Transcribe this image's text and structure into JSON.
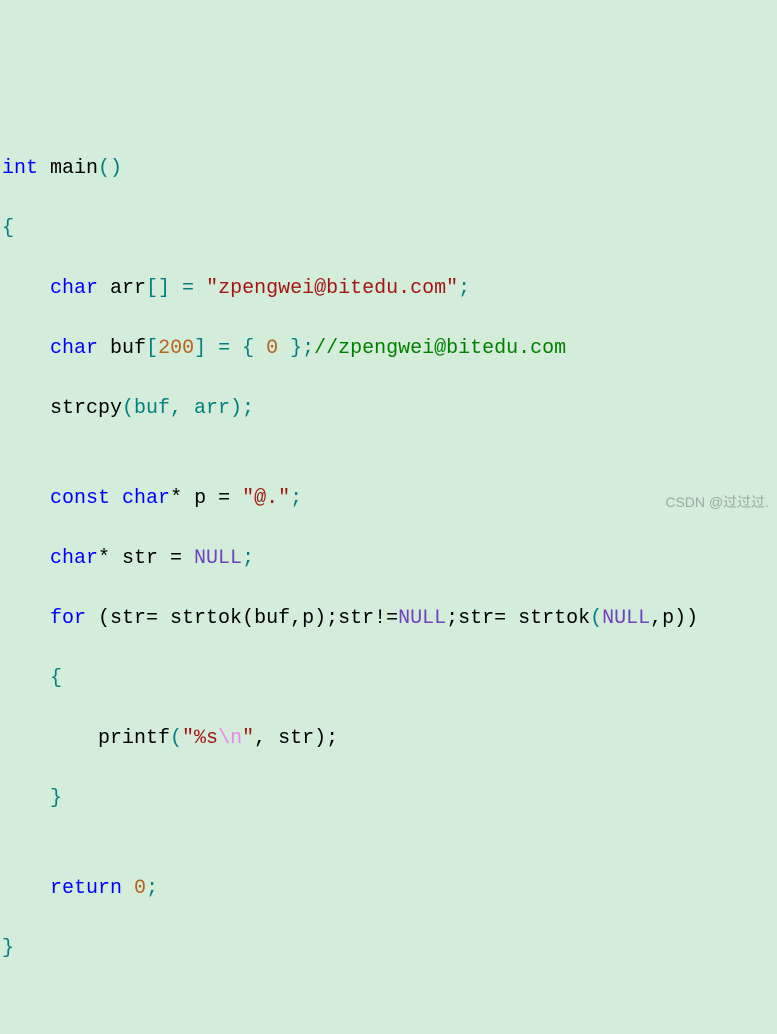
{
  "code": {
    "l1_kw1": "int",
    "l1_func": " main",
    "l1_p1": "()",
    "l2_brace": "{",
    "l3_indent": "    ",
    "l3_kw": "char",
    "l3_id": " arr",
    "l3_p1": "[] = ",
    "l3_str": "\"zpengwei@bitedu.com\"",
    "l3_p2": ";",
    "l4_indent": "    ",
    "l4_kw": "char",
    "l4_id": " buf",
    "l4_p1": "[",
    "l4_num": "200",
    "l4_p2": "] = { ",
    "l4_num2": "0",
    "l4_p3": " };",
    "l4_comment": "//zpengwei@bitedu.com",
    "l5_indent": "    ",
    "l5_fn": "strcpy",
    "l5_p1": "(buf, arr);",
    "l6_blank": "",
    "l7_indent": "    ",
    "l7_kw1": "const",
    "l7_sp": " ",
    "l7_kw2": "char",
    "l7_p1": "* p = ",
    "l7_str": "\"@.\"",
    "l7_p2": ";",
    "l8_indent": "    ",
    "l8_kw": "char",
    "l8_p1": "* str = ",
    "l8_null": "NULL",
    "l8_p2": ";",
    "l9_indent": "    ",
    "l9_kw": "for",
    "l9_p1": " (str= ",
    "l9_fn1": "strtok",
    "l9_p2": "(buf,p);str!=",
    "l9_null": "NULL",
    "l9_p3": ";str= ",
    "l9_fn2": "strtok",
    "l9_p4": "(",
    "l9_null2": "NULL",
    "l9_p5": ",p))",
    "l10_indent": "    ",
    "l10_brace": "{",
    "l11_indent": "        ",
    "l11_fn": "printf",
    "l11_p1": "(",
    "l11_str1": "\"%s",
    "l11_esc": "\\n",
    "l11_str2": "\"",
    "l11_p2": ", str);",
    "l12_indent": "    ",
    "l12_brace": "}",
    "l13_blank": "",
    "l14_indent": "    ",
    "l14_kw": "return",
    "l14_sp": " ",
    "l14_num": "0",
    "l14_p": ";",
    "l15_brace": "}"
  },
  "watermark": "CSDN @过过过."
}
